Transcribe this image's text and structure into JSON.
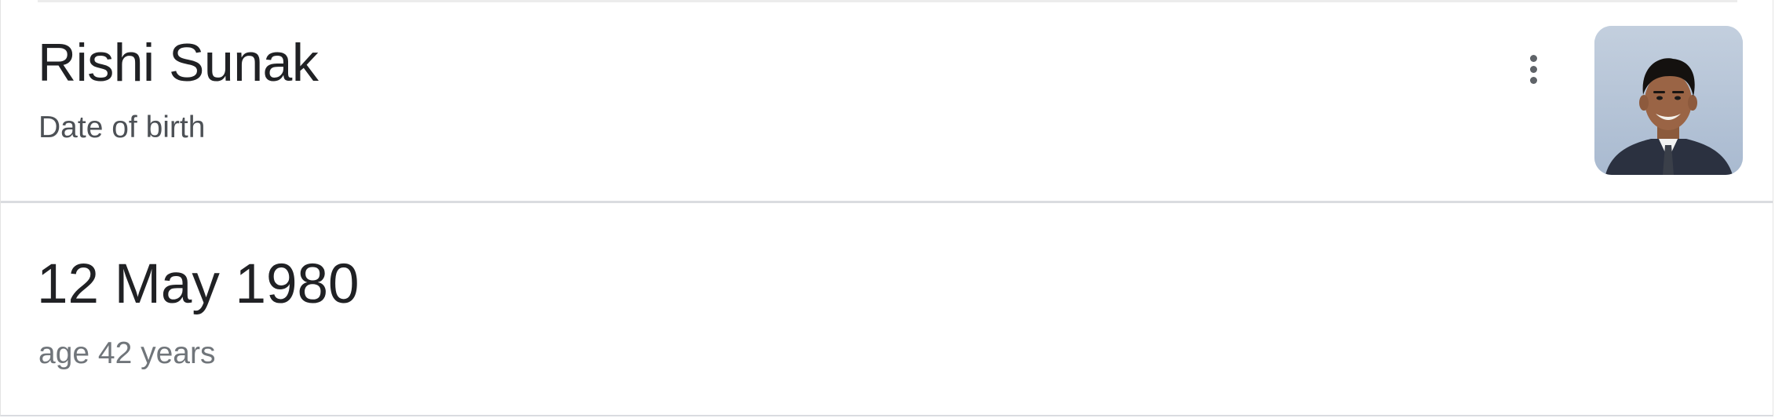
{
  "knowledge_panel": {
    "entity_name": "Rishi Sunak",
    "attribute_label": "Date of birth",
    "more_options_icon": "more-vert-icon",
    "portrait_alt": "Rishi Sunak"
  },
  "answer": {
    "value": "12 May 1980",
    "detail": "age 42 years"
  },
  "colors": {
    "title_text": "#202124",
    "secondary_text": "#4d5156",
    "muted_text": "#70757a",
    "divider": "#dadce0",
    "icon": "#5f6368",
    "portrait_background": "#b5c4d8"
  }
}
